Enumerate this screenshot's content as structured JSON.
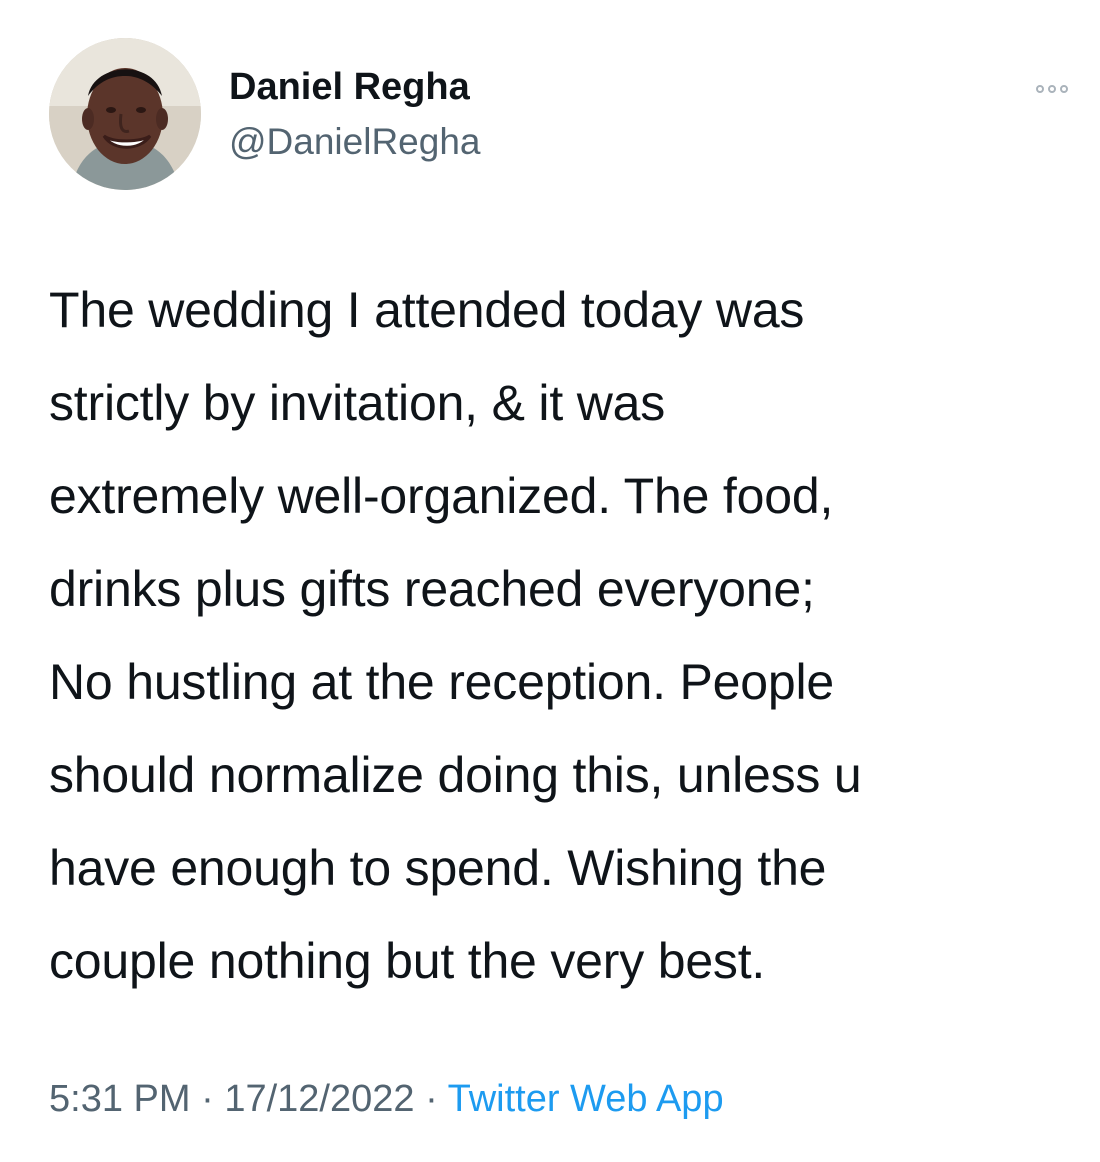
{
  "author": {
    "display_name": "Daniel Regha",
    "handle": "@DanielRegha",
    "avatar_icon": "user-profile-photo"
  },
  "tweet": {
    "lines": [
      "The wedding I attended today was",
      "strictly by invitation, & it was",
      "extremely well-organized. The food,",
      "drinks plus gifts reached everyone;",
      "No hustling at the reception. People",
      "should normalize doing this, unless u",
      "have enough to spend. Wishing the",
      "couple nothing but the very best."
    ],
    "time": "5:31 PM",
    "separator": "·",
    "date": "17/12/2022",
    "source": "Twitter Web App"
  },
  "actions": {
    "more_icon": "more-horizontal-icon"
  },
  "colors": {
    "text": "#0f1419",
    "secondary": "#536471",
    "link": "#1d9bf0",
    "background": "#ffffff"
  }
}
